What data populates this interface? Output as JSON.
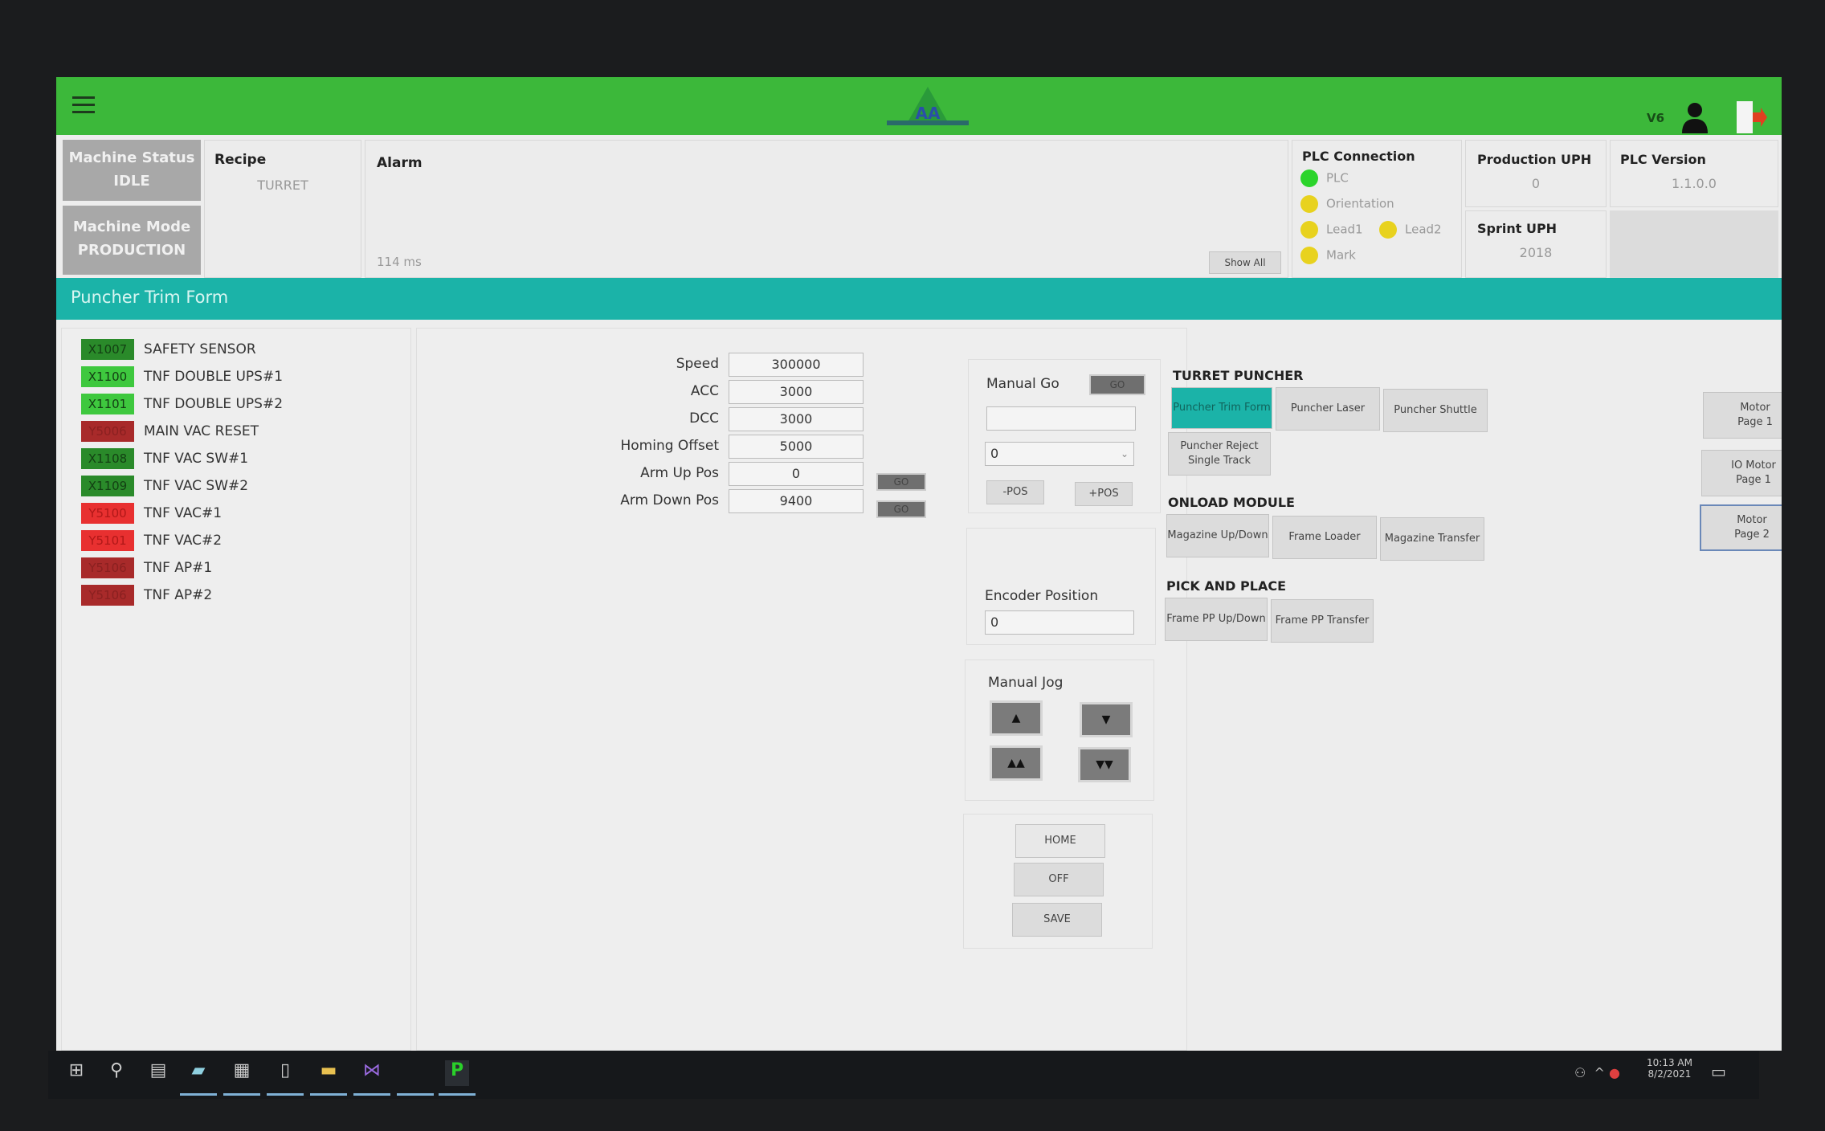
{
  "header": {
    "user_label": "V6",
    "logo_text": "AA"
  },
  "status": {
    "machine_status_label": "Machine Status",
    "machine_status": "IDLE",
    "machine_mode_label": "Machine Mode",
    "machine_mode": "PRODUCTION",
    "recipe_label": "Recipe",
    "recipe": "TURRET",
    "alarm_label": "Alarm",
    "latency": "114 ms",
    "show_all": "Show All",
    "plc_connection_label": "PLC Connection",
    "plc_items": [
      {
        "label": "PLC",
        "color": "#2bd42b"
      },
      {
        "label": "Orientation",
        "color": "#e8d21e"
      },
      {
        "label": "Lead1",
        "color": "#e8d21e"
      },
      {
        "label": "Lead2",
        "color": "#e8d21e"
      },
      {
        "label": "Mark",
        "color": "#e8d21e"
      }
    ],
    "production_uph_label": "Production UPH",
    "production_uph": "0",
    "sprint_uph_label": "Sprint UPH",
    "sprint_uph": "2018",
    "plc_version_label": "PLC Version",
    "plc_version": "1.1.0.0"
  },
  "form_title": "Puncher Trim  Form",
  "io_list": [
    {
      "code": "X1007",
      "label": "SAFETY SENSOR",
      "color": "#2a8a2a",
      "text": "#134013"
    },
    {
      "code": "X1100",
      "label": "TNF DOUBLE UPS#1",
      "color": "#3ec83e",
      "text": "#134013"
    },
    {
      "code": "X1101",
      "label": "TNF DOUBLE UPS#2",
      "color": "#3ec83e",
      "text": "#134013"
    },
    {
      "code": "Y5006",
      "label": "MAIN VAC RESET",
      "color": "#a82a2a",
      "text": "#8a2020"
    },
    {
      "code": "X1108",
      "label": "TNF VAC SW#1",
      "color": "#2a8a2a",
      "text": "#134013"
    },
    {
      "code": "X1109",
      "label": "TNF VAC SW#2",
      "color": "#2a8a2a",
      "text": "#134013"
    },
    {
      "code": "Y5100",
      "label": "TNF VAC#1",
      "color": "#e83030",
      "text": "#b01818"
    },
    {
      "code": "Y5101",
      "label": "TNF VAC#2",
      "color": "#e83030",
      "text": "#b01818"
    },
    {
      "code": "Y5106",
      "label": "TNF AP#1",
      "color": "#a82a2a",
      "text": "#8a2020"
    },
    {
      "code": "Y5106",
      "label": "TNF AP#2",
      "color": "#a82a2a",
      "text": "#8a2020"
    }
  ],
  "params": [
    {
      "label": "Speed",
      "value": "300000"
    },
    {
      "label": "ACC",
      "value": "3000"
    },
    {
      "label": "DCC",
      "value": "3000"
    },
    {
      "label": "Homing Offset",
      "value": "5000"
    },
    {
      "label": "Arm Up Pos",
      "value": "0"
    },
    {
      "label": "Arm Down Pos",
      "value": "9400"
    }
  ],
  "go_label": "GO",
  "manual_go": {
    "label": "Manual Go",
    "input": "",
    "select": "0",
    "minus": "-POS",
    "plus": "+POS"
  },
  "encoder": {
    "label": "Encoder Position",
    "value": "0"
  },
  "jog": {
    "label": "Manual Jog",
    "up": "▲",
    "down": "▼",
    "fast_up": "▲▲",
    "fast_down": "▼▼"
  },
  "actions": {
    "home": "HOME",
    "off": "OFF",
    "save": "SAVE"
  },
  "nav": {
    "turret_title": "TURRET PUNCHER",
    "turret": [
      "Puncher Trim Form",
      "Puncher Laser",
      "Puncher Shuttle",
      "Puncher Reject Single Track"
    ],
    "onload_title": "ONLOAD MODULE",
    "onload": [
      "Magazine Up/Down",
      "Frame Loader",
      "Magazine Transfer"
    ],
    "pnp_title": "PICK AND PLACE",
    "pnp": [
      "Frame PP Up/Down",
      "Frame PP Transfer"
    ],
    "pages": [
      "Motor Page 1",
      "IO Motor Page 1",
      "Motor Page 2"
    ]
  },
  "taskbar": {
    "time": "10:13 AM",
    "date": "8/2/2021"
  },
  "colors": {
    "header": "#3cb83a",
    "teal": "#1bb3a8"
  }
}
